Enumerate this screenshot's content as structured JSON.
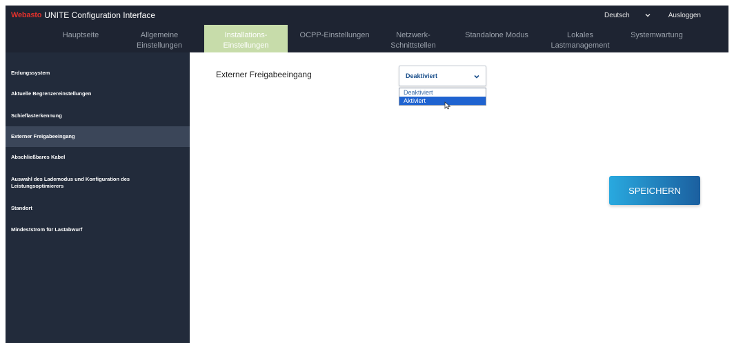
{
  "header": {
    "logo_text": "Webasto",
    "title": "UNITE Configuration Interface",
    "language": "Deutsch",
    "logout_label": "Ausloggen"
  },
  "nav": {
    "tabs": [
      {
        "label_line1": "Hauptseite",
        "label_line2": ""
      },
      {
        "label_line1": "Allgemeine",
        "label_line2": "Einstellungen"
      },
      {
        "label_line1": "Installations-",
        "label_line2": "Einstellungen",
        "active": true
      },
      {
        "label_line1": "OCPP-Einstellungen",
        "label_line2": ""
      },
      {
        "label_line1": "Netzwerk-",
        "label_line2": "Schnittstellen"
      },
      {
        "label_line1": "Standalone Modus",
        "label_line2": ""
      },
      {
        "label_line1": "Lokales",
        "label_line2": "Lastmanagement"
      },
      {
        "label_line1": "Systemwartung",
        "label_line2": ""
      }
    ]
  },
  "sidebar": {
    "items": [
      {
        "line1": "Erdungssystem",
        "line2": ""
      },
      {
        "line1": "Aktuelle Begrenzereinstellungen",
        "line2": ""
      },
      {
        "line1": "Schieflasterkennung",
        "line2": ""
      },
      {
        "line1": "Externer Freigabeeingang",
        "line2": "",
        "active": true
      },
      {
        "line1": "Abschließbares Kabel",
        "line2": ""
      },
      {
        "line1": "Auswahl des Lademodus und Konfiguration des",
        "line2": "Leistungsoptimierers"
      },
      {
        "line1": "Standort",
        "line2": ""
      },
      {
        "line1": "Mindeststrom für Lastabwurf",
        "line2": ""
      }
    ]
  },
  "main": {
    "setting_label": "Externer Freigabeeingang",
    "select": {
      "value": "Deaktiviert",
      "options": [
        "Deaktiviert",
        "Aktiviert"
      ],
      "highlighted_option": "Aktiviert"
    },
    "save_label": "SPEICHERN"
  },
  "colors": {
    "header_bg": "#1e2432",
    "sidebar_bg": "#222b3b",
    "active_tab_bg": "#c7dcaa",
    "brand_red": "#e0312c",
    "highlight_blue": "#1f63d0"
  }
}
